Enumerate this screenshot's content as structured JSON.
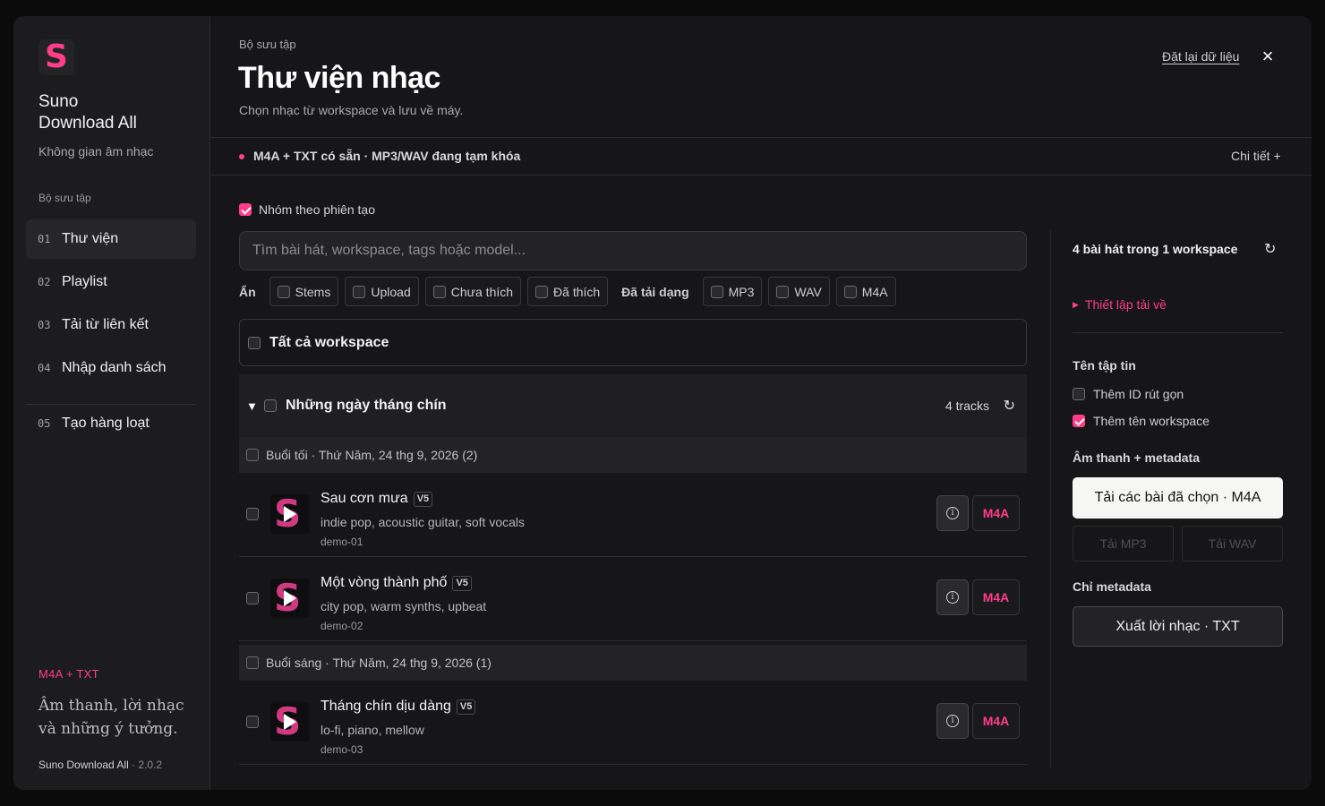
{
  "brand": {
    "logo_letter": "S",
    "name_line1": "Suno",
    "name_line2": "Download All",
    "tagline": "Không gian âm nhạc",
    "accent_color": "#ff3d8b"
  },
  "sidebar": {
    "section_label": "Bộ sưu tập",
    "items": [
      {
        "num": "01",
        "label": "Thư viện",
        "active": true
      },
      {
        "num": "02",
        "label": "Playlist"
      },
      {
        "num": "03",
        "label": "Tải từ liên kết"
      },
      {
        "num": "04",
        "label": "Nhập danh sách"
      },
      {
        "num": "05",
        "label": "Tạo hàng loạt"
      }
    ],
    "format_tag": "M4A + TXT",
    "quote_line1": "Âm thanh, lời nhạc",
    "quote_line2": "và những ý tưởng.",
    "app_name": "Suno Download All",
    "version": " · 2.0.2"
  },
  "header": {
    "breadcrumb": "Bộ sưu tập",
    "title": "Thư viện nhạc",
    "subtitle": "Chọn nhạc từ workspace và lưu về máy.",
    "reset_label": "Đặt lại dữ liệu",
    "close_icon": "×"
  },
  "notice": {
    "text": "M4A + TXT có sẵn · MP3/WAV đang tạm khóa",
    "details_label": "Chi tiết +"
  },
  "library": {
    "group_toggle_label": "Nhóm theo phiên tạo",
    "search_placeholder": "Tìm bài hát, workspace, tags hoặc model...",
    "hide_label": "Ẩn",
    "hide_filters": [
      "Stems",
      "Upload",
      "Chưa thích",
      "Đã thích"
    ],
    "downloaded_label": "Đã tải dạng",
    "downloaded_filters": [
      "MP3",
      "WAV",
      "M4A"
    ],
    "all_workspaces_label": "Tất cả workspace",
    "group": {
      "title": "Những ngày tháng chín",
      "count": "4 tracks"
    },
    "sessions": [
      {
        "label": "Buổi tối · Thứ Năm, 24 thg 9, 2026 (2)"
      },
      {
        "label": "Buổi sáng · Thứ Năm, 24 thg 9, 2026 (1)"
      }
    ],
    "tracks": [
      {
        "title": "Sau cơn mưa",
        "version": "V5",
        "tags": "indie pop, acoustic guitar, soft vocals",
        "id": "demo-01",
        "format": "M4A"
      },
      {
        "title": "Một vòng thành phố",
        "version": "V5",
        "tags": "city pop, warm synths, upbeat",
        "id": "demo-02",
        "format": "M4A"
      },
      {
        "title": "Tháng chín dịu dàng",
        "version": "V5",
        "tags": "lo-fi, piano, mellow",
        "id": "demo-03",
        "format": "M4A"
      }
    ]
  },
  "panel": {
    "summary": "4 bài hát trong 1 workspace",
    "setup_label": "Thiết lập tải về",
    "filename_heading": "Tên tập tin",
    "opt_short_id": "Thêm ID rút gọn",
    "opt_workspace": "Thêm tên workspace",
    "audio_heading": "Âm thanh + metadata",
    "download_selected": "Tải các bài đã chọn · M4A",
    "download_mp3": "Tải MP3",
    "download_wav": "Tải WAV",
    "metadata_heading": "Chỉ metadata",
    "export_lyrics": "Xuất lời nhạc · TXT"
  }
}
